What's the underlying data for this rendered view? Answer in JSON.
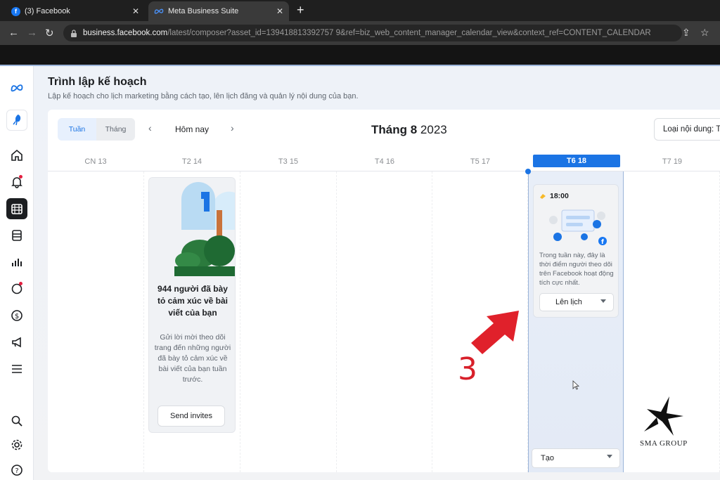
{
  "browser": {
    "tabs": [
      {
        "label": "(3) Facebook",
        "favicon": "facebook-icon"
      },
      {
        "label": "Meta Business Suite",
        "favicon": "meta-icon"
      }
    ],
    "url_host": "business.facebook.com",
    "url_path": "/latest/composer?asset_id=139418813392757 9&ref=biz_web_content_manager_calendar_view&context_ref=CONTENT_CALENDAR"
  },
  "page": {
    "title": "Trình lập kế hoạch",
    "subtitle": "Lập kế hoạch cho lịch marketing bằng cách tạo, lên lịch đăng và quản lý nội dung của bạn."
  },
  "toolbar": {
    "view_week": "Tuần",
    "view_month": "Tháng",
    "today": "Hôm nay",
    "month_name": "Tháng 8",
    "year": "2023",
    "content_type": "Loại nội dung: T"
  },
  "days": [
    "CN 13",
    "T2 14",
    "T3 15",
    "T4 16",
    "T5 17",
    "T6 18",
    "T7 19"
  ],
  "selected_day": "T6 18",
  "insight_card": {
    "headline": "944 người đã bày tỏ cảm xúc về bài viết của bạn",
    "body": "Gửi lời mời theo dõi trang đến những người đã bày tỏ cảm xúc về bài viết của bạn tuần trước.",
    "button": "Send invites"
  },
  "tip_card": {
    "time": "18:00",
    "body": "Trong tuần này, đây là thời điểm người theo dõi trên Facebook hoạt động tích cực nhất.",
    "button": "Lên lịch"
  },
  "create_button": "Tạo",
  "annotation": {
    "step": "3"
  },
  "watermark": "SMA GROUP",
  "colors": {
    "accent": "#1b74e4",
    "arrow": "#d8202a"
  }
}
